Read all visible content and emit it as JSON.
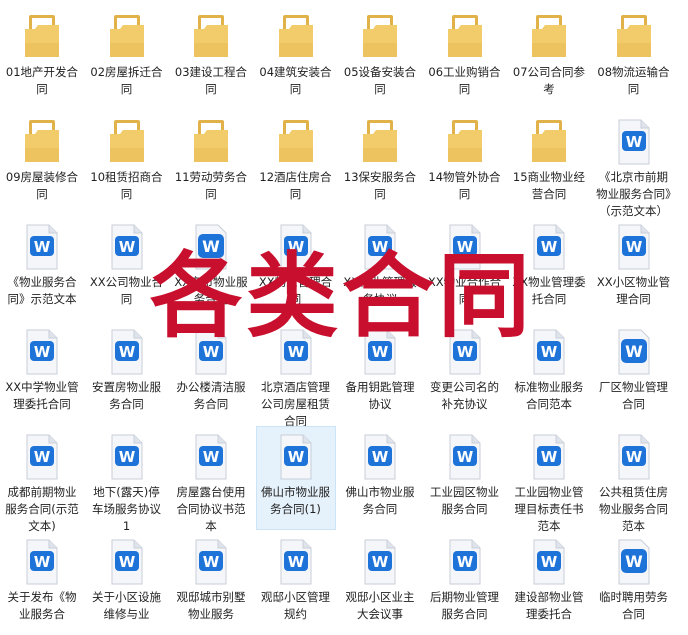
{
  "colors": {
    "folder": "#f2cc6b",
    "folder_dark": "#e2b24a",
    "paper": "#f4f6fa",
    "wps_blue": "#1e73d8",
    "selected_bg": "#e5f1fb",
    "watermark": "#c8102e"
  },
  "watermark": "各类合同",
  "items": [
    {
      "label": "01地产开发合同",
      "type": "folder"
    },
    {
      "label": "02房屋拆迁合同",
      "type": "folder"
    },
    {
      "label": "03建设工程合同",
      "type": "folder"
    },
    {
      "label": "04建筑安装合同",
      "type": "folder"
    },
    {
      "label": "05设备安装合同",
      "type": "folder"
    },
    {
      "label": "06工业购销合同",
      "type": "folder"
    },
    {
      "label": "07公司合同参考",
      "type": "folder"
    },
    {
      "label": "08物流运输合同",
      "type": "folder"
    },
    {
      "label": "09房屋装修合同",
      "type": "folder"
    },
    {
      "label": "10租赁招商合同",
      "type": "folder"
    },
    {
      "label": "11劳动劳务合同",
      "type": "folder"
    },
    {
      "label": "12酒店住房合同",
      "type": "folder"
    },
    {
      "label": "13保安服务合同",
      "type": "folder"
    },
    {
      "label": "14物管外协合同",
      "type": "folder"
    },
    {
      "label": "15商业物业经营合同",
      "type": "folder"
    },
    {
      "label": "《北京市前期物业服务合同》（示范文本）",
      "type": "doc"
    },
    {
      "label": "《物业服务合同》示范文本",
      "type": "doc"
    },
    {
      "label": "XX公司物业合同",
      "type": "doc"
    },
    {
      "label": "XX京市物业服务合同",
      "type": "doc_solid"
    },
    {
      "label": "XX物业管理合同",
      "type": "doc"
    },
    {
      "label": "XX物业管理服务协议",
      "type": "doc"
    },
    {
      "label": "XX物业合作合同",
      "type": "doc"
    },
    {
      "label": "XX物业管理委托合同",
      "type": "doc"
    },
    {
      "label": "XX小区物业管理合同",
      "type": "doc"
    },
    {
      "label": "XX中学物业管理委托合同",
      "type": "doc"
    },
    {
      "label": "安置房物业服务合同",
      "type": "doc"
    },
    {
      "label": "办公楼清洁服务合同",
      "type": "doc"
    },
    {
      "label": "北京酒店管理公司房屋租赁合同",
      "type": "doc"
    },
    {
      "label": "备用钥匙管理协议",
      "type": "doc"
    },
    {
      "label": "变更公司名的补充协议",
      "type": "doc"
    },
    {
      "label": "标准物业服务合同范本",
      "type": "doc"
    },
    {
      "label": "厂区物业管理合同",
      "type": "doc_solid"
    },
    {
      "label": "成都前期物业服务合同(示范文本)",
      "type": "doc"
    },
    {
      "label": "地下(露天)停车场服务协议1",
      "type": "doc"
    },
    {
      "label": "房屋露台使用合同协议书范本",
      "type": "doc"
    },
    {
      "label": "佛山市物业服务合同(1)",
      "type": "doc",
      "selected": true
    },
    {
      "label": "佛山市物业服务合同",
      "type": "doc"
    },
    {
      "label": "工业园区物业服务合同",
      "type": "doc"
    },
    {
      "label": "工业园物业管理目标责任书范本",
      "type": "doc"
    },
    {
      "label": "公共租赁住房物业服务合同范本",
      "type": "doc"
    },
    {
      "label": "关于发布《物业服务合",
      "type": "doc"
    },
    {
      "label": "关于小区设施维修与业",
      "type": "doc"
    },
    {
      "label": "观邸城市别墅物业服务",
      "type": "doc"
    },
    {
      "label": "观邸小区管理规约",
      "type": "doc"
    },
    {
      "label": "观邸小区业主大会议事",
      "type": "doc"
    },
    {
      "label": "后期物业管理服务合同",
      "type": "doc"
    },
    {
      "label": "建设部物业管理委托合",
      "type": "doc"
    },
    {
      "label": "临时聘用劳务合同",
      "type": "doc_solid"
    }
  ]
}
